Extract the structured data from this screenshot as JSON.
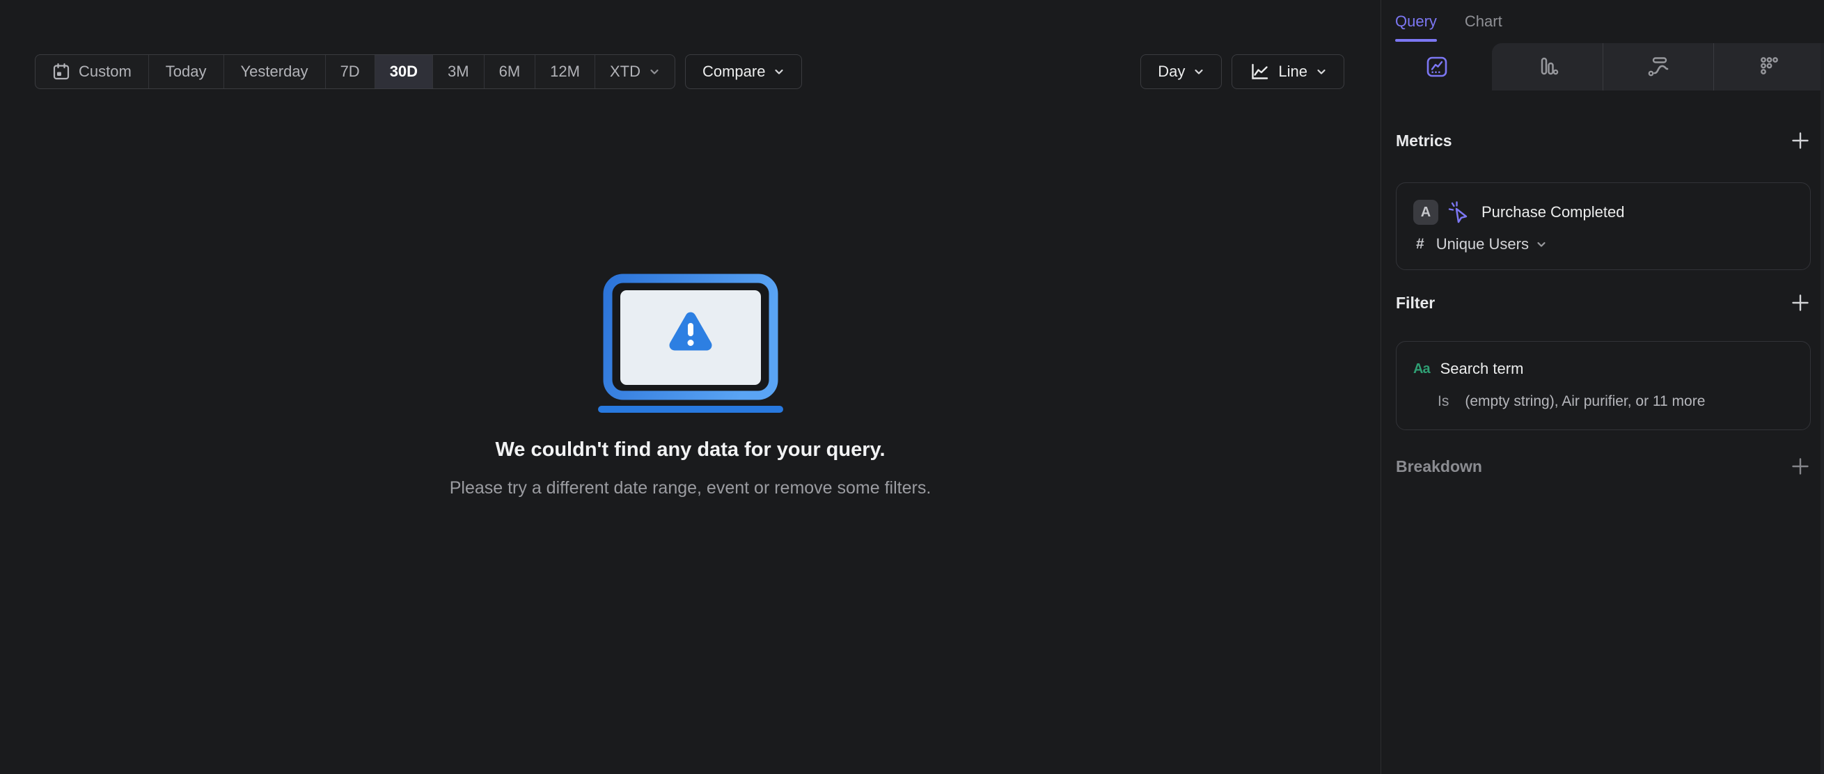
{
  "colors": {
    "background": "#1a1b1d",
    "accent_purple": "#7c77f3",
    "selected_segment_bg": "#2f3038",
    "green_property": "#2f9e73",
    "illustration_blue": "#2c79dc",
    "illustration_blue_light": "#5aa4f4",
    "illustration_screen": "#e9eef3"
  },
  "toolbar": {
    "date_ranges": [
      {
        "label": "Custom",
        "selected": false
      },
      {
        "label": "Today",
        "selected": false
      },
      {
        "label": "Yesterday",
        "selected": false
      },
      {
        "label": "7D",
        "selected": false
      },
      {
        "label": "30D",
        "selected": true
      },
      {
        "label": "3M",
        "selected": false
      },
      {
        "label": "6M",
        "selected": false
      },
      {
        "label": "12M",
        "selected": false
      },
      {
        "label": "XTD",
        "selected": false
      }
    ],
    "compare_label": "Compare",
    "granularity_label": "Day",
    "chart_type_label": "Line"
  },
  "empty_state": {
    "title": "We couldn't find any data for your query.",
    "subtitle": "Please try a different date range, event or remove some filters."
  },
  "sidebar": {
    "tabs": [
      {
        "label": "Query",
        "active": true
      },
      {
        "label": "Chart",
        "active": false
      }
    ],
    "icon_tabs": [
      {
        "icon": "insights-line-chart-icon",
        "active": true
      },
      {
        "icon": "bar-chart-icon",
        "active": false
      },
      {
        "icon": "flows-icon",
        "active": false
      },
      {
        "icon": "retention-dots-icon",
        "active": false
      }
    ],
    "metrics": {
      "header": "Metrics",
      "items": [
        {
          "letter": "A",
          "event": "Purchase Completed",
          "aggregation_symbol": "#",
          "aggregation": "Unique Users"
        }
      ]
    },
    "filter": {
      "header": "Filter",
      "items": [
        {
          "type_icon": "Aa",
          "property": "Search term",
          "operator": "Is",
          "value": "(empty string), Air purifier, or 11 more"
        }
      ]
    },
    "breakdown": {
      "header": "Breakdown"
    }
  }
}
